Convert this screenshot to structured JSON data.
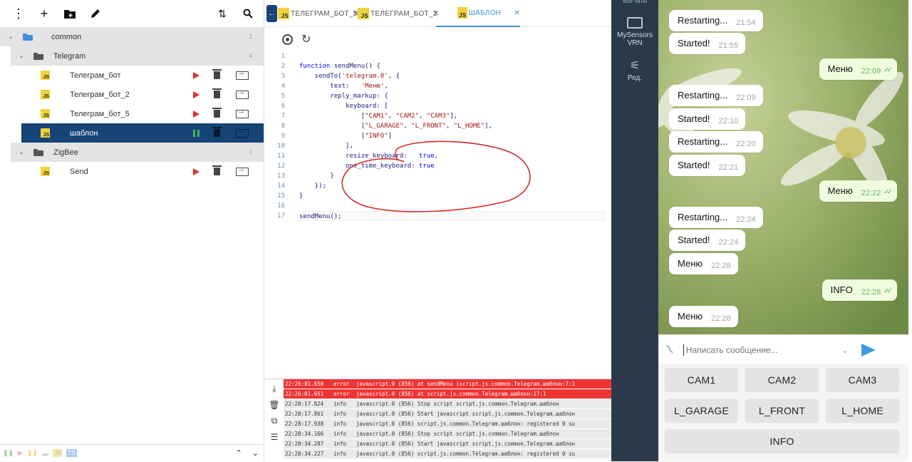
{
  "tree": {
    "toolbar_icons": [
      "more-vert-icon",
      "add-icon",
      "add-folder-icon",
      "edit-icon",
      "sort-icon",
      "search-icon"
    ],
    "rows": [
      {
        "type": "folder",
        "label": "common",
        "count": "2",
        "folder_color": "blue"
      },
      {
        "type": "folder",
        "label": "Telegram",
        "count": "4",
        "folder_color": "dark"
      },
      {
        "type": "script",
        "label": "Телеграм_бот",
        "running": false
      },
      {
        "type": "script",
        "label": "Телеграм_бот_2",
        "running": false
      },
      {
        "type": "script",
        "label": "Телеграм_бот_5",
        "running": false
      },
      {
        "type": "script",
        "label": "шаблон",
        "running": true,
        "selected": true
      },
      {
        "type": "folder",
        "label": "ZigBee",
        "count": "1",
        "folder_color": "dark"
      },
      {
        "type": "script",
        "label": "Send",
        "running": false
      }
    ],
    "footer": {
      "js": "JS",
      "ts": "TS"
    }
  },
  "editor": {
    "tabs": [
      {
        "label": "ТЕЛЕГРАМ_БОТ_5",
        "active": false
      },
      {
        "label": "ТЕЛЕГРАМ_БОТ_2",
        "active": false
      },
      {
        "label": "ШАБЛОН",
        "active": true
      }
    ],
    "js_badge": "JS",
    "line_numbers": [
      "1",
      "2",
      "3",
      "4",
      "5",
      "6",
      "7",
      "8",
      "9",
      "10",
      "11",
      "12",
      "13",
      "14",
      "15",
      "16",
      "17"
    ]
  },
  "log": {
    "rows": [
      {
        "time": "22:26:01.650",
        "severity": "error",
        "message": "javascript.0 (856) at sendMenu (script.js.common.Telegram.шаблон:7:1"
      },
      {
        "time": "22:26:01.651",
        "severity": "error",
        "message": "javascript.0 (856) at script.js.common.Telegram.шаблон:17:1"
      },
      {
        "time": "22:28:17.824",
        "severity": "info",
        "message": "javascript.0 (856) Stop script script.js.common.Telegram.шаблон"
      },
      {
        "time": "22:28:17.861",
        "severity": "info",
        "message": "javascript.0 (856) Start javascript script.js.common.Telegram.шаблон"
      },
      {
        "time": "22:28:17.938",
        "severity": "info",
        "message": "javascript.0 (856) script.js.common.Telegram.шаблон: registered 0 su"
      },
      {
        "time": "22:28:34.166",
        "severity": "info",
        "message": "javascript.0 (856) Stop script script.js.common.Telegram.шаблон"
      },
      {
        "time": "22:28:34.207",
        "severity": "info",
        "message": "javascript.0 (856) Start javascript script.js.common.Telegram.шаблон"
      },
      {
        "time": "22:28:34.227",
        "severity": "info",
        "message": "javascript.0 (856) script.js.common.Telegram.шаблон: registered 0 su"
      }
    ]
  },
  "telegram": {
    "sidebar": {
      "top_label": "Все чаты",
      "folder_label_1": "MySensors",
      "folder_label_2": "VRN",
      "edit_label": "Ред."
    },
    "messages": [
      {
        "text": "Restarting...",
        "time": "21:54",
        "out": false
      },
      {
        "text": "Started!",
        "time": "21:55",
        "out": false
      },
      {
        "text": "Меню",
        "time": "22:09",
        "out": true
      },
      {
        "text": "Restarting...",
        "time": "22:09",
        "out": false
      },
      {
        "text": "Started!",
        "time": "22:10",
        "out": false
      },
      {
        "text": "Restarting...",
        "time": "22:20",
        "out": false
      },
      {
        "text": "Started!",
        "time": "22:21",
        "out": false
      },
      {
        "text": "Меню",
        "time": "22:22",
        "out": true
      },
      {
        "text": "Restarting...",
        "time": "22:24",
        "out": false
      },
      {
        "text": "Started!",
        "time": "22:24",
        "out": false
      },
      {
        "text": "Меню",
        "time": "22:28",
        "out": false
      },
      {
        "text": "INFO",
        "time": "22:28",
        "out": true
      },
      {
        "text": "Меню",
        "time": "22:28",
        "out": false
      }
    ],
    "composer_placeholder": "Написать сообщение...",
    "keyboard": [
      [
        "CAM1",
        "CAM2",
        "CAM3"
      ],
      [
        "L_GARAGE",
        "L_FRONT",
        "L_HOME"
      ],
      [
        "INFO"
      ]
    ]
  }
}
